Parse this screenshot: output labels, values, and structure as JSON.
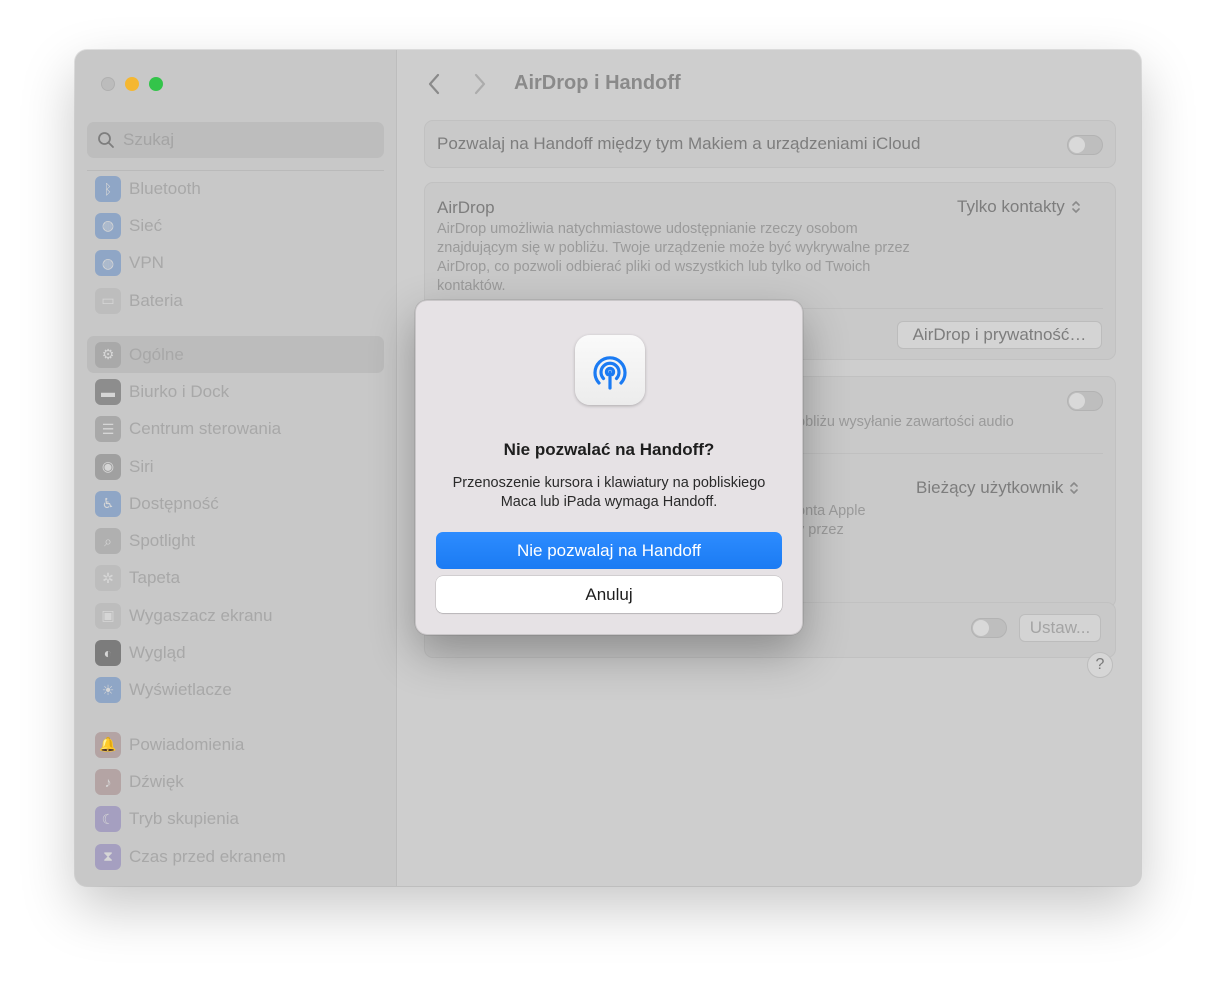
{
  "window": {
    "title": "AirDrop i Handoff"
  },
  "search": {
    "placeholder": "Szukaj"
  },
  "sidebar": {
    "group1": [
      {
        "label": "Bluetooth",
        "icon": "bluetooth-icon",
        "color": "#8fa6c6"
      },
      {
        "label": "Sieć",
        "icon": "globe-icon",
        "color": "#8fa6c6"
      },
      {
        "label": "VPN",
        "icon": "vpn-globe-icon",
        "color": "#8fa6c6"
      },
      {
        "label": "Bateria",
        "icon": "battery-icon",
        "color": "#bdbdbd"
      }
    ],
    "group2": [
      {
        "label": "Ogólne",
        "icon": "gear-icon",
        "color": "#a9a9a9",
        "active": true
      },
      {
        "label": "Biurko i Dock",
        "icon": "dock-icon",
        "color": "#8d8d8d"
      },
      {
        "label": "Centrum sterowania",
        "icon": "control-center-icon",
        "color": "#a9a9a9"
      },
      {
        "label": "Siri",
        "icon": "siri-icon",
        "color": "#a0a0a0"
      },
      {
        "label": "Dostępność",
        "icon": "accessibility-icon",
        "color": "#8fa6c6"
      },
      {
        "label": "Spotlight",
        "icon": "spotlight-icon",
        "color": "#b0b0b0"
      },
      {
        "label": "Tapeta",
        "icon": "wallpaper-icon",
        "color": "#bdbdbd"
      },
      {
        "label": "Wygaszacz ekranu",
        "icon": "screensaver-icon",
        "color": "#bdbdbd"
      },
      {
        "label": "Wygląd",
        "icon": "appearance-icon",
        "color": "#7c7c7c"
      },
      {
        "label": "Wyświetlacze",
        "icon": "displays-icon",
        "color": "#8fa6c6"
      }
    ],
    "group3": [
      {
        "label": "Powiadomienia",
        "icon": "notifications-icon",
        "color": "#b4a4a4"
      },
      {
        "label": "Dźwięk",
        "icon": "sound-icon",
        "color": "#b4a4a4"
      },
      {
        "label": "Tryb skupienia",
        "icon": "focus-moon-icon",
        "color": "#a59fc0"
      },
      {
        "label": "Czas przed ekranem",
        "icon": "screen-time-icon",
        "color": "#a59fc0"
      }
    ]
  },
  "main": {
    "handoff_row": {
      "label": "Pozwalaj na Handoff między tym Makiem a urządzeniami iCloud",
      "on": false
    },
    "airdrop": {
      "label": "AirDrop",
      "description": "AirDrop umożliwia natychmiastowe udostępnianie rzeczy osobom znajdującym się w pobliżu. Twoje urządzenie może być wykrywalne przez AirDrop, co pozwoli odbierać pliki od wszystkich lub tylko od Twoich kontaktów.",
      "value": "Tylko kontakty",
      "privacy_button": "AirDrop i prywatność…"
    },
    "airplay": {
      "partial_desc": "obliżu wysyłanie zawartości audio",
      "on": false
    },
    "receiver": {
      "value": "Bieżący użytkownik",
      "partial_desc_1": "onta Apple",
      "partial_desc_2": "y przez"
    },
    "last_row": {
      "button": "Ustaw...",
      "on": false
    },
    "help": "?"
  },
  "dialog": {
    "icon": "airdrop-icon",
    "title": "Nie pozwalać na Handoff?",
    "message": "Przenoszenie kursora i klawiatury na pobliskiego Maca lub iPada wymaga Handoff.",
    "primary_button": "Nie pozwalaj na Handoff",
    "secondary_button": "Anuluj",
    "accent": "#1b7bf3"
  }
}
